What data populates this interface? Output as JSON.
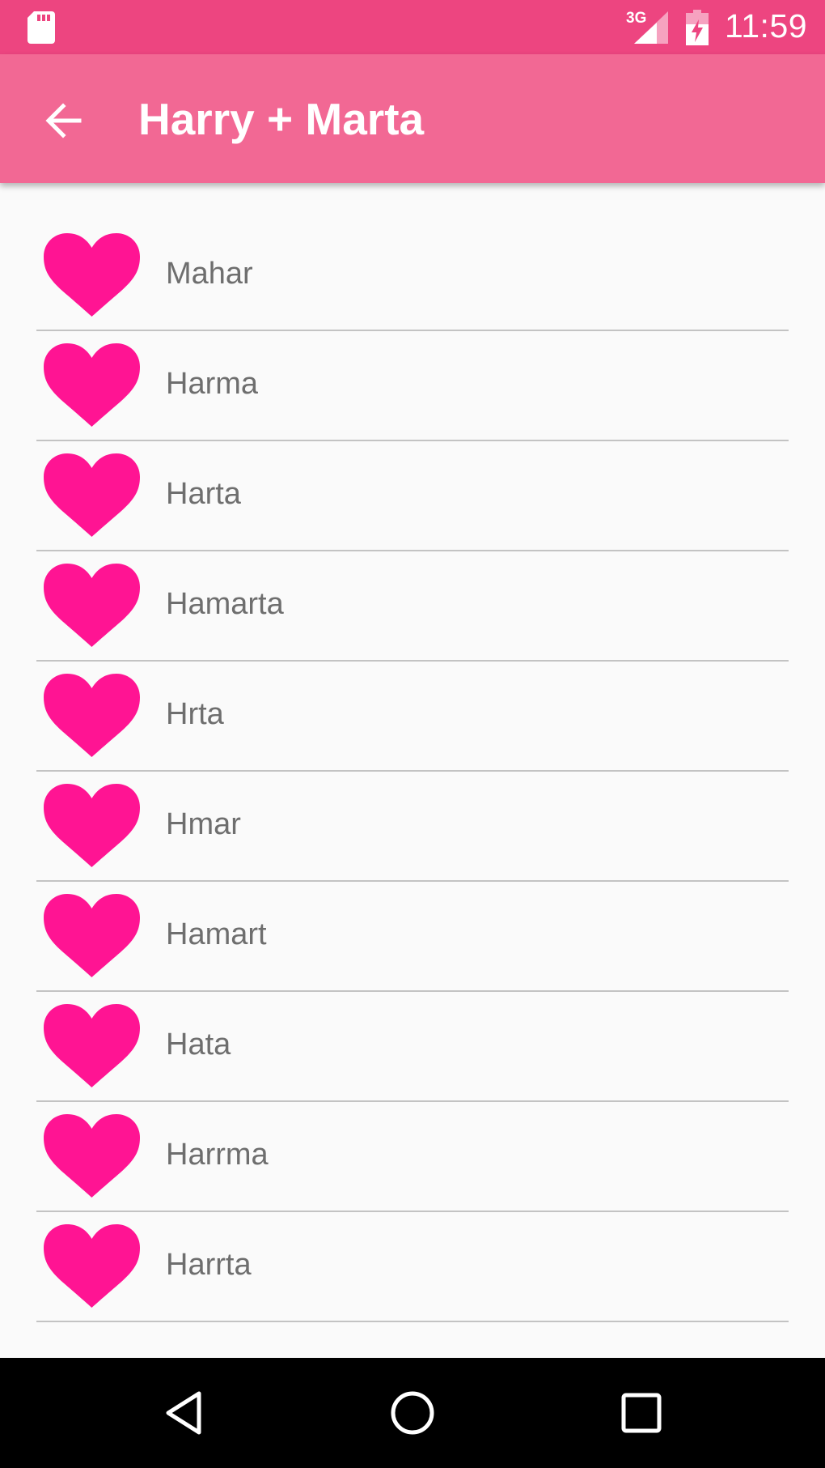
{
  "status_bar": {
    "network": "3G",
    "time": "11:59",
    "icons": [
      "sd-card-icon",
      "signal-icon",
      "battery-charging-icon"
    ]
  },
  "app_bar": {
    "title": "Harry + Marta",
    "back_icon": "arrow-back-icon"
  },
  "colors": {
    "status_bar": "#ed4580",
    "app_bar": "#f26894",
    "heart": "#ff1493",
    "item_text": "#6e6e6e",
    "divider": "#c3c3c3",
    "background": "#fafafa"
  },
  "names": [
    {
      "label": "Mahar",
      "icon": "heart-icon"
    },
    {
      "label": "Harma",
      "icon": "heart-icon"
    },
    {
      "label": "Harta",
      "icon": "heart-icon"
    },
    {
      "label": "Hamarta",
      "icon": "heart-icon"
    },
    {
      "label": "Hrta",
      "icon": "heart-icon"
    },
    {
      "label": "Hmar",
      "icon": "heart-icon"
    },
    {
      "label": "Hamart",
      "icon": "heart-icon"
    },
    {
      "label": "Hata",
      "icon": "heart-icon"
    },
    {
      "label": "Harrma",
      "icon": "heart-icon"
    },
    {
      "label": "Harrta",
      "icon": "heart-icon"
    }
  ],
  "nav_bar": {
    "buttons": [
      "nav-back-icon",
      "nav-home-icon",
      "nav-recents-icon"
    ]
  }
}
